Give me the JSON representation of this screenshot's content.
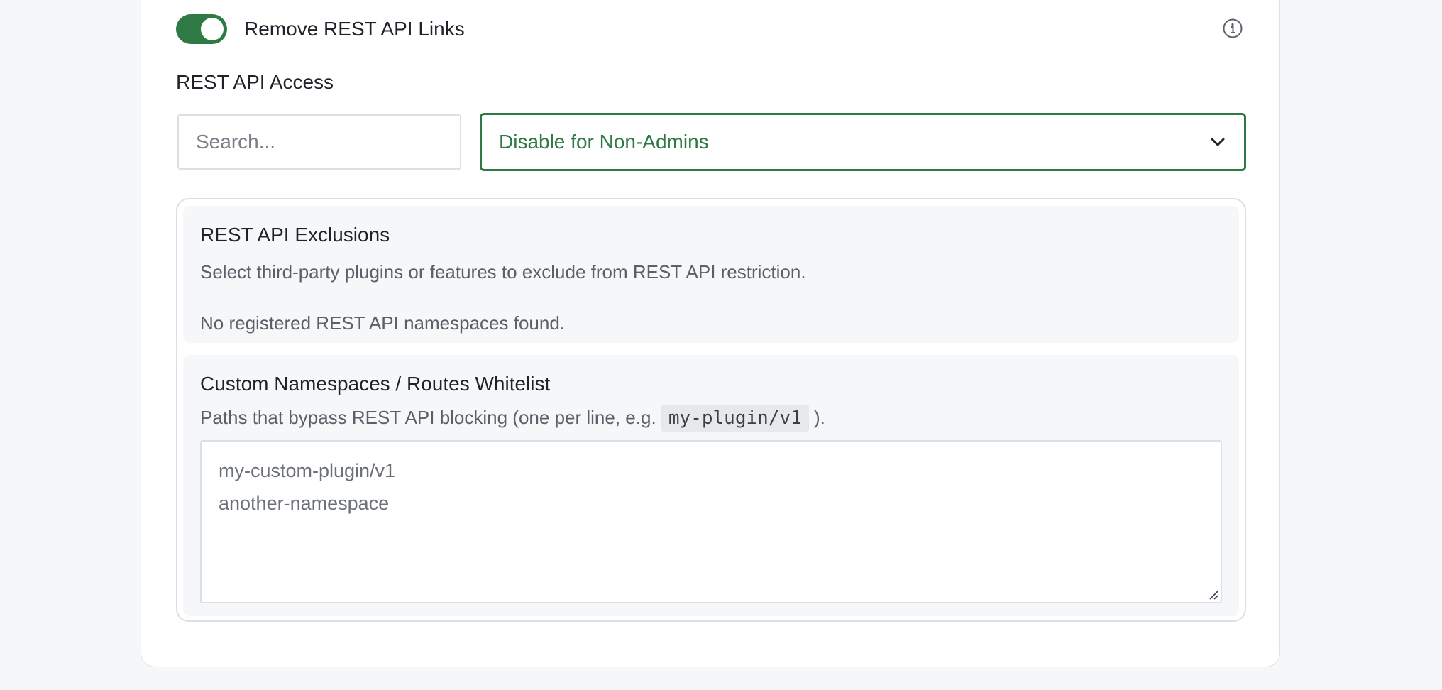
{
  "settings": {
    "remove_rest_links": {
      "label": "Remove REST API Links",
      "enabled": true
    },
    "rest_access": {
      "label": "REST API Access",
      "search_placeholder": "Search...",
      "selected": "Disable for Non-Admins"
    },
    "exclusions": {
      "title": "REST API Exclusions",
      "description": "Select third-party plugins or features to exclude from REST API restriction.",
      "empty_message": "No registered REST API namespaces found."
    },
    "whitelist": {
      "title": "Custom Namespaces / Routes Whitelist",
      "description_before": "Paths that bypass REST API blocking (one per line, e.g.",
      "description_code": "my-plugin/v1",
      "description_after": ").",
      "lines": [
        "my-custom-plugin/v1",
        "another-namespace"
      ]
    }
  },
  "icons": {
    "info": "info-icon",
    "chevron": "chevron-down-icon",
    "resize": "resize-grip-icon"
  },
  "colors": {
    "accent": "#2f7a44",
    "page_bg": "#f6f7f9",
    "border": "#dcdfe4",
    "muted_text": "#5b6068"
  }
}
